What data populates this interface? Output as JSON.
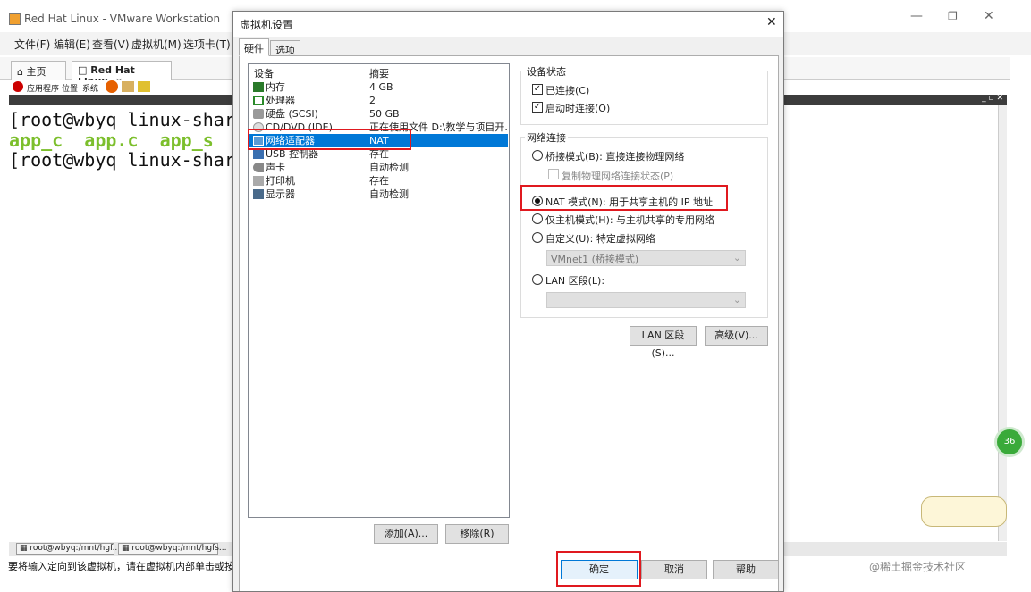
{
  "app": {
    "window_title": "Red Hat Linux - VMware Workstation",
    "menu": [
      "文件(F)",
      "编辑(E)",
      "查看(V)",
      "虚拟机(M)",
      "选项卡(T)"
    ],
    "tabs": [
      {
        "label": "主页"
      },
      {
        "label": "Red Hat Linux"
      }
    ],
    "toolbar": [
      "应用程序",
      "位置",
      "系统"
    ],
    "console_lines": [
      {
        "text": "[root@wbyq linux-share",
        "color": "#111111"
      },
      {
        "text": "app_c  app.c  app_s  g",
        "color": "#7cbf2c"
      },
      {
        "text": "[root@wbyq linux-share",
        "color": "#111111"
      }
    ],
    "taskbar": [
      "root@wbyq:/mnt/hgf...",
      "root@wbyq:/mnt/hgfs..."
    ],
    "status": "要将输入定向到该虚拟机，请在虚拟机内部单击或按 C",
    "side_badge": "36",
    "watermark": "@稀土掘金技术社区"
  },
  "dialog": {
    "title": "虚拟机设置",
    "tabs": [
      {
        "label": "硬件",
        "active": true
      },
      {
        "label": "选项",
        "active": false
      }
    ],
    "device_header": {
      "device": "设备",
      "summary": "摘要"
    },
    "devices": [
      {
        "name": "内存",
        "summary": "4 GB",
        "icon": "memory-icon"
      },
      {
        "name": "处理器",
        "summary": "2",
        "icon": "cpu-icon"
      },
      {
        "name": "硬盘 (SCSI)",
        "summary": "50 GB",
        "icon": "disk-icon"
      },
      {
        "name": "CD/DVD (IDE)",
        "summary": "正在使用文件 D:\\教学与项目开...",
        "icon": "cd-icon"
      },
      {
        "name": "网络适配器",
        "summary": "NAT",
        "icon": "network-icon",
        "selected": true
      },
      {
        "name": "USB 控制器",
        "summary": "存在",
        "icon": "usb-icon"
      },
      {
        "name": "声卡",
        "summary": "自动检测",
        "icon": "sound-icon"
      },
      {
        "name": "打印机",
        "summary": "存在",
        "icon": "printer-icon"
      },
      {
        "name": "显示器",
        "summary": "自动检测",
        "icon": "monitor-icon"
      }
    ],
    "add_button": "添加(A)...",
    "remove_button": "移除(R)",
    "device_status": {
      "label": "设备状态",
      "connected": {
        "label": "已连接(C)",
        "checked": true
      },
      "connect_on_start": {
        "label": "启动时连接(O)",
        "checked": true
      }
    },
    "network": {
      "label": "网络连接",
      "bridged": "桥接模式(B): 直接连接物理网络",
      "replicate": "复制物理网络连接状态(P)",
      "nat": "NAT 模式(N): 用于共享主机的 IP 地址",
      "host_only": "仅主机模式(H): 与主机共享的专用网络",
      "custom": "自定义(U): 特定虚拟网络",
      "custom_select": "VMnet1 (桥接模式)",
      "lan": "LAN 区段(L):",
      "lan_select": "",
      "selected": "nat"
    },
    "lan_segment_button": "LAN 区段(S)...",
    "advanced_button": "高级(V)...",
    "ok_button": "确定",
    "cancel_button": "取消",
    "help_button": "帮助"
  },
  "colors": {
    "highlight": "#0078d7",
    "red_box": "#e0191f",
    "console_green": "#7cbf2c"
  }
}
